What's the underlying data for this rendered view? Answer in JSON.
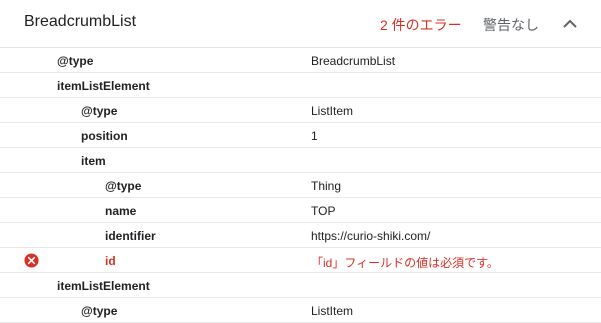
{
  "header": {
    "title": "BreadcrumbList",
    "errors_label": "2 件のエラー",
    "warnings_label": "警告なし",
    "toggle_icon": "chevron-up-icon"
  },
  "colors": {
    "error": "#d93025",
    "muted": "#5f6368",
    "divider": "#e8e8e8"
  },
  "rows": [
    {
      "key": "@type",
      "value": "BreadcrumbList",
      "level": 1,
      "error": false
    },
    {
      "key": "itemListElement",
      "value": "",
      "level": 1,
      "error": false
    },
    {
      "key": "@type",
      "value": "ListItem",
      "level": 2,
      "error": false
    },
    {
      "key": "position",
      "value": "1",
      "level": 2,
      "error": false
    },
    {
      "key": "item",
      "value": "",
      "level": 2,
      "error": false
    },
    {
      "key": "@type",
      "value": "Thing",
      "level": 3,
      "error": false
    },
    {
      "key": "name",
      "value": "TOP",
      "level": 3,
      "error": false
    },
    {
      "key": "identifier",
      "value": "https://curio-shiki.com/",
      "level": 3,
      "error": false
    },
    {
      "key": "id",
      "value": "「id」フィールドの値は必須です。",
      "level": 3,
      "error": true,
      "icon": "error-icon"
    },
    {
      "key": "itemListElement",
      "value": "",
      "level": 1,
      "error": false
    },
    {
      "key": "@type",
      "value": "ListItem",
      "level": 2,
      "error": false
    }
  ]
}
